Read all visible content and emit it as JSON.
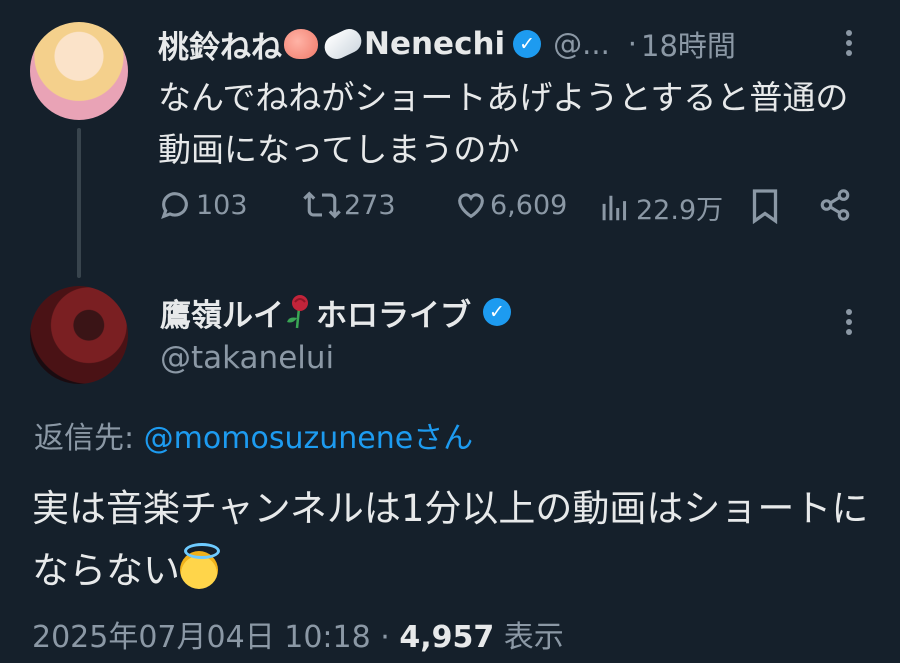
{
  "tweet1": {
    "display_name": "桃鈴ねね",
    "display_name_suffix": "Nenechi",
    "handle_truncated": "@...",
    "time": "18時間",
    "text": "なんでねねがショートあげようとすると普通の動画になってしまうのか",
    "stats": {
      "replies": "103",
      "retweets": "273",
      "likes": "6,609",
      "views": "22.9万"
    }
  },
  "tweet2": {
    "display_name": "鷹嶺ルイ",
    "display_name_suffix": "ホロライブ",
    "handle": "@takanelui",
    "reply_label": "返信先:",
    "reply_target": "@momosuzunene",
    "reply_suffix": "さん",
    "text": "実は音楽チャンネルは1分以上の動画はショートにならない",
    "date": "2025年07月04日 10:18",
    "separator": "·",
    "views": "4,957",
    "views_label": "表示"
  },
  "icons": [
    "verified-badge-icon",
    "peach-emoji",
    "cloud-emoji",
    "rose-emoji",
    "halo-emoji",
    "more-icon",
    "reply-icon",
    "retweet-icon",
    "like-icon",
    "views-icon",
    "bookmark-icon",
    "share-icon"
  ],
  "colors": {
    "background": "#15202b",
    "accent": "#1d9bf0",
    "muted": "#8b98a5",
    "text": "#e7e9ea"
  }
}
